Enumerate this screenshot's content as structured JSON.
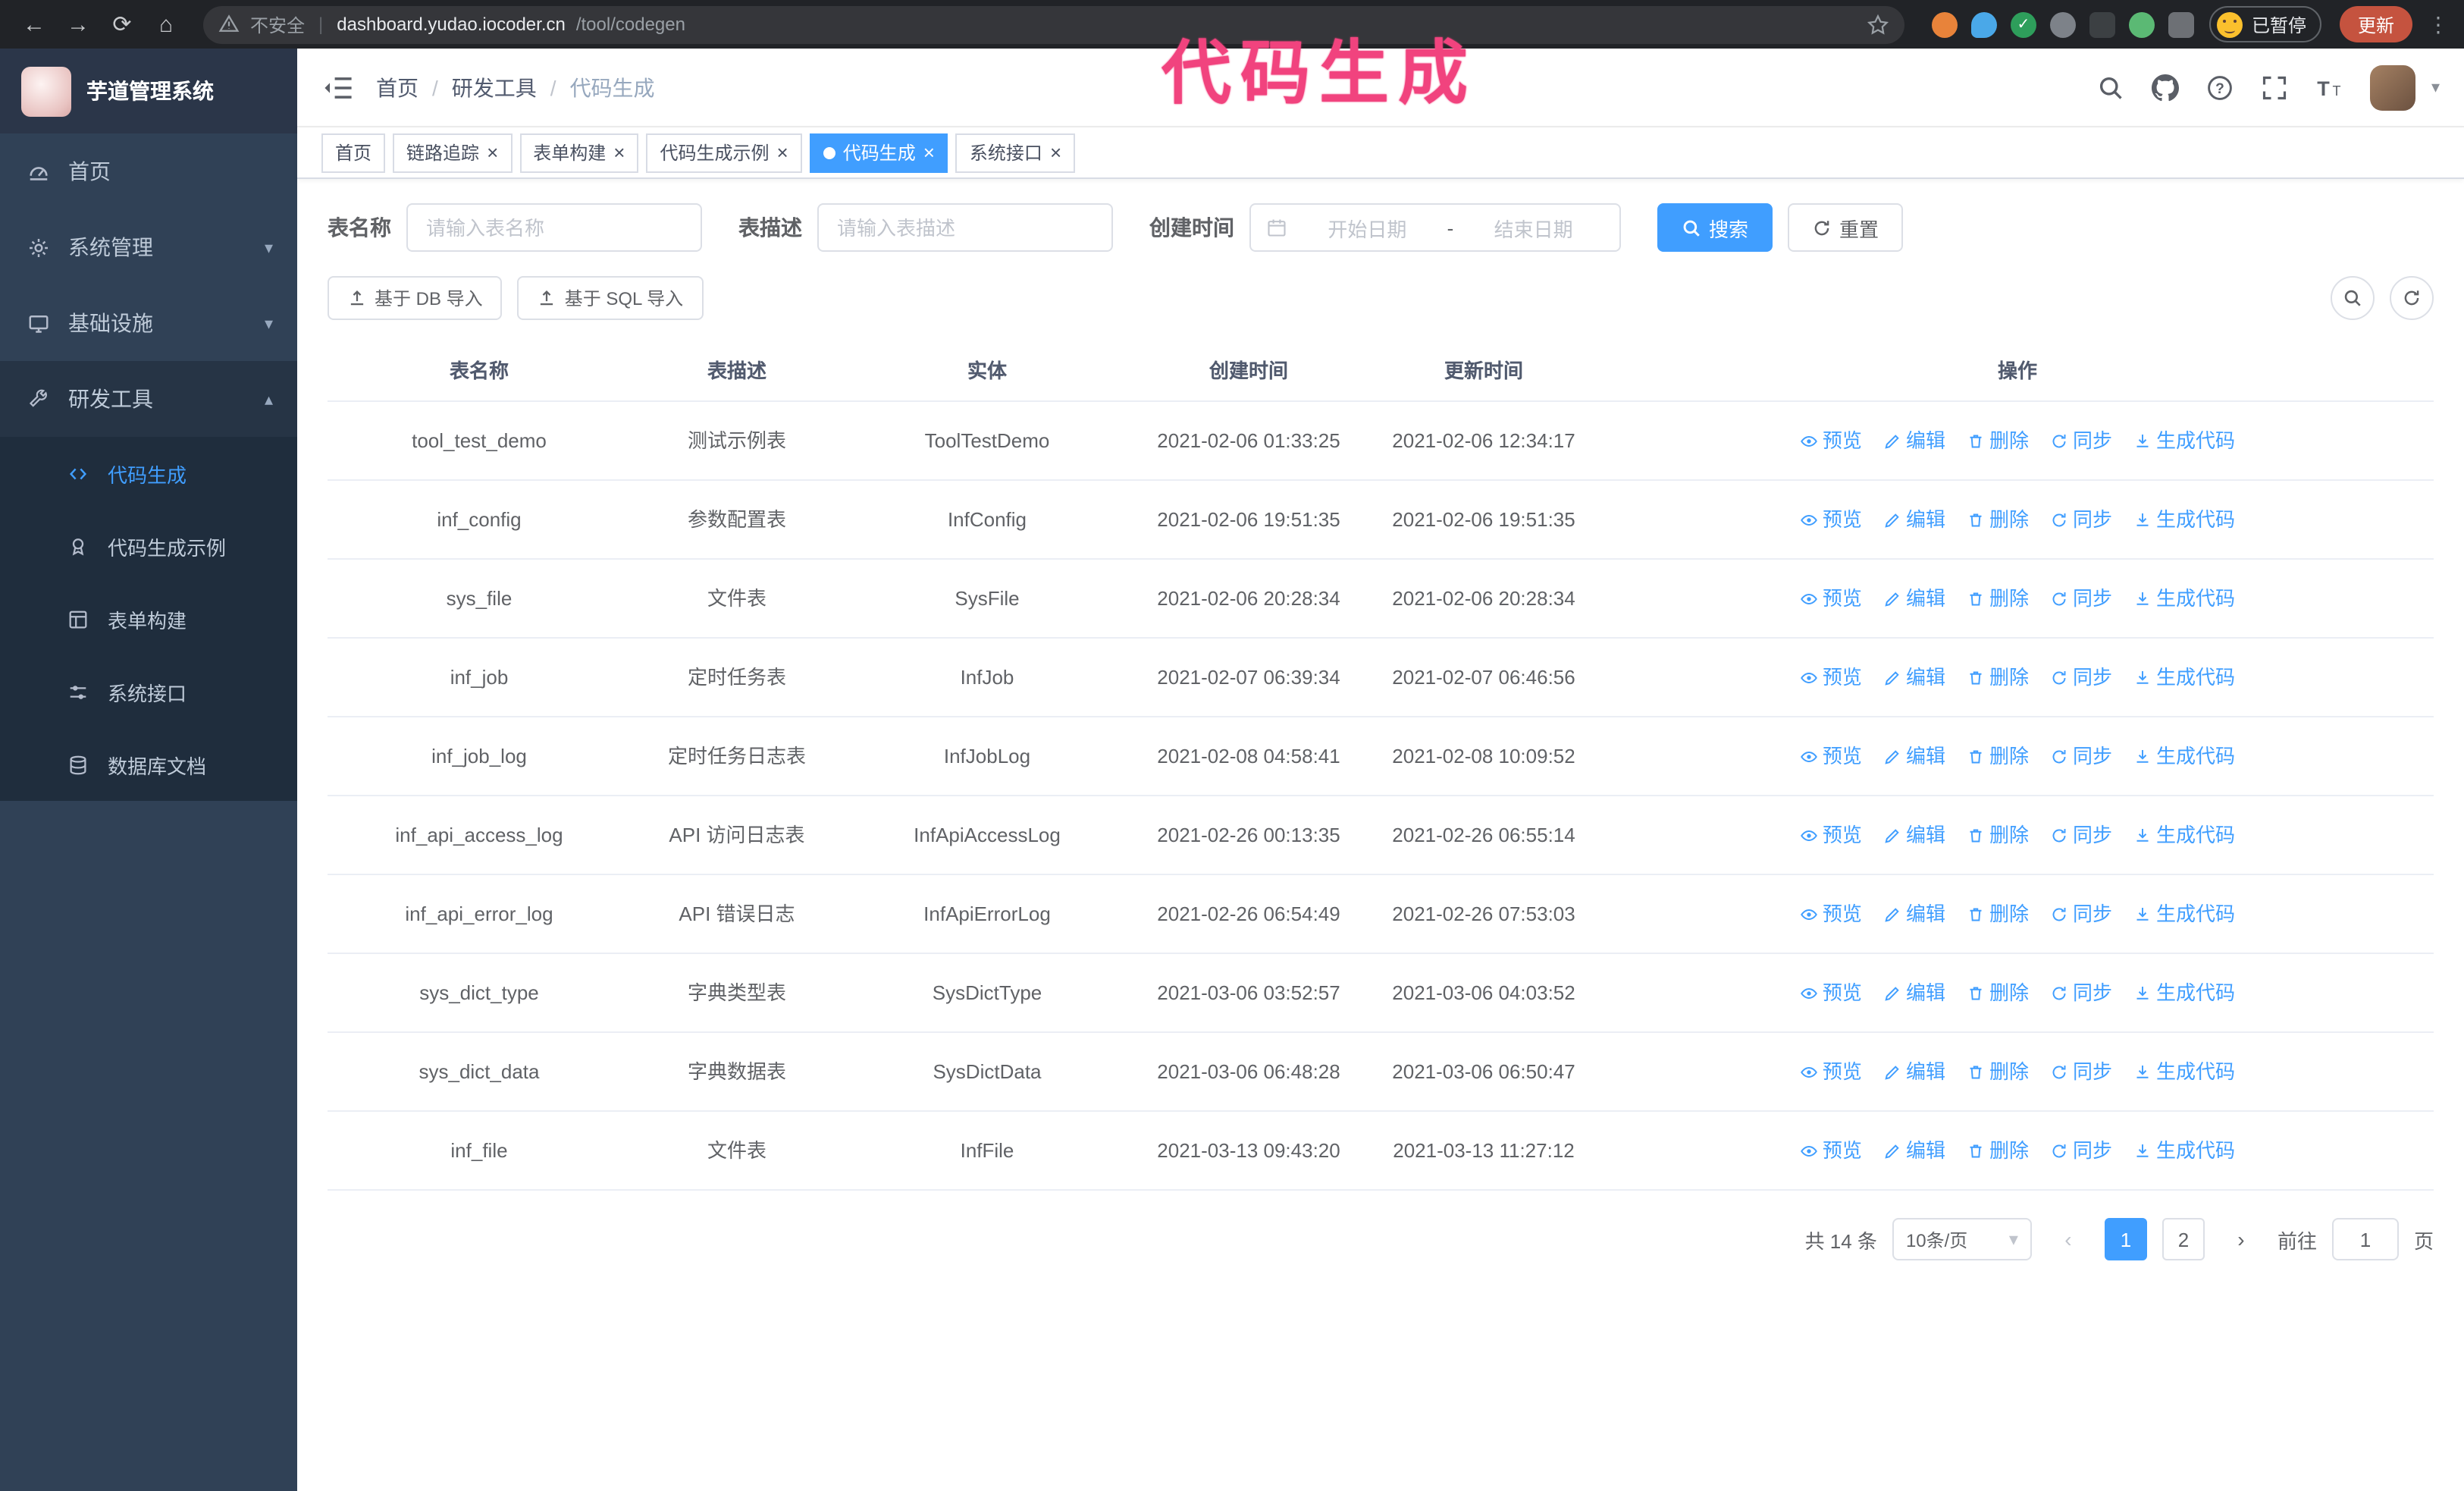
{
  "browser": {
    "security_text": "不安全",
    "url_domain": "dashboard.yudao.iocoder.cn",
    "url_path": "/tool/codegen",
    "paused_label": "已暂停",
    "update_label": "更新"
  },
  "icons": {
    "back": "←",
    "forward": "→",
    "reload": "⟳",
    "home": "⌂",
    "caret_down": "▾",
    "caret_up": "▴",
    "close": "×",
    "prev": "‹",
    "next": "›",
    "dots": "⋮"
  },
  "annotation": {
    "text": "代码生成"
  },
  "sidebar": {
    "logo_title": "芋道管理系统",
    "items": [
      {
        "label": "首页"
      },
      {
        "label": "系统管理"
      },
      {
        "label": "基础设施"
      },
      {
        "label": "研发工具"
      }
    ],
    "submenu": [
      {
        "label": "代码生成",
        "active": true
      },
      {
        "label": "代码生成示例"
      },
      {
        "label": "表单构建"
      },
      {
        "label": "系统接口"
      },
      {
        "label": "数据库文档"
      }
    ]
  },
  "header": {
    "breadcrumb": [
      "首页",
      "研发工具",
      "代码生成"
    ],
    "separator": "/"
  },
  "tabs": [
    {
      "label": "首页",
      "closable": false,
      "active": false
    },
    {
      "label": "链路追踪",
      "closable": true,
      "active": false
    },
    {
      "label": "表单构建",
      "closable": true,
      "active": false
    },
    {
      "label": "代码生成示例",
      "closable": true,
      "active": false
    },
    {
      "label": "代码生成",
      "closable": true,
      "active": true
    },
    {
      "label": "系统接口",
      "closable": true,
      "active": false
    }
  ],
  "filters": {
    "table_name_label": "表名称",
    "table_name_placeholder": "请输入表名称",
    "table_desc_label": "表描述",
    "table_desc_placeholder": "请输入表描述",
    "create_time_label": "创建时间",
    "date_start_placeholder": "开始日期",
    "date_separator": "-",
    "date_end_placeholder": "结束日期",
    "search_button": "搜索",
    "reset_button": "重置"
  },
  "toolbar": {
    "import_db_label": "基于 DB 导入",
    "import_sql_label": "基于 SQL 导入"
  },
  "table": {
    "columns": [
      "表名称",
      "表描述",
      "实体",
      "创建时间",
      "更新时间",
      "操作"
    ],
    "actions": [
      "预览",
      "编辑",
      "删除",
      "同步",
      "生成代码"
    ],
    "rows": [
      {
        "name": "tool_test_demo",
        "desc": "测试示例表",
        "entity": "ToolTestDemo",
        "created": "2021-02-06 01:33:25",
        "updated": "2021-02-06 12:34:17"
      },
      {
        "name": "inf_config",
        "desc": "参数配置表",
        "entity": "InfConfig",
        "created": "2021-02-06 19:51:35",
        "updated": "2021-02-06 19:51:35"
      },
      {
        "name": "sys_file",
        "desc": "文件表",
        "entity": "SysFile",
        "created": "2021-02-06 20:28:34",
        "updated": "2021-02-06 20:28:34"
      },
      {
        "name": "inf_job",
        "desc": "定时任务表",
        "entity": "InfJob",
        "created": "2021-02-07 06:39:34",
        "updated": "2021-02-07 06:46:56"
      },
      {
        "name": "inf_job_log",
        "desc": "定时任务日志表",
        "entity": "InfJobLog",
        "created": "2021-02-08 04:58:41",
        "updated": "2021-02-08 10:09:52"
      },
      {
        "name": "inf_api_access_log",
        "desc": "API 访问日志表",
        "entity": "InfApiAccessLog",
        "created": "2021-02-26 00:13:35",
        "updated": "2021-02-26 06:55:14"
      },
      {
        "name": "inf_api_error_log",
        "desc": "API 错误日志",
        "entity": "InfApiErrorLog",
        "created": "2021-02-26 06:54:49",
        "updated": "2021-02-26 07:53:03"
      },
      {
        "name": "sys_dict_type",
        "desc": "字典类型表",
        "entity": "SysDictType",
        "created": "2021-03-06 03:52:57",
        "updated": "2021-03-06 04:03:52"
      },
      {
        "name": "sys_dict_data",
        "desc": "字典数据表",
        "entity": "SysDictData",
        "created": "2021-03-06 06:48:28",
        "updated": "2021-03-06 06:50:47"
      },
      {
        "name": "inf_file",
        "desc": "文件表",
        "entity": "InfFile",
        "created": "2021-03-13 09:43:20",
        "updated": "2021-03-13 11:27:12"
      }
    ]
  },
  "pagination": {
    "total_label": "共 14 条",
    "page_size_label": "10条/页",
    "pages": [
      {
        "label": "1",
        "active": true
      },
      {
        "label": "2",
        "active": false
      }
    ],
    "goto_label": "前往",
    "goto_value": "1",
    "unit_label": "页"
  },
  "colors": {
    "primary": "#409eff",
    "sidebar_bg": "#304156",
    "annotation": "#f1437e"
  }
}
